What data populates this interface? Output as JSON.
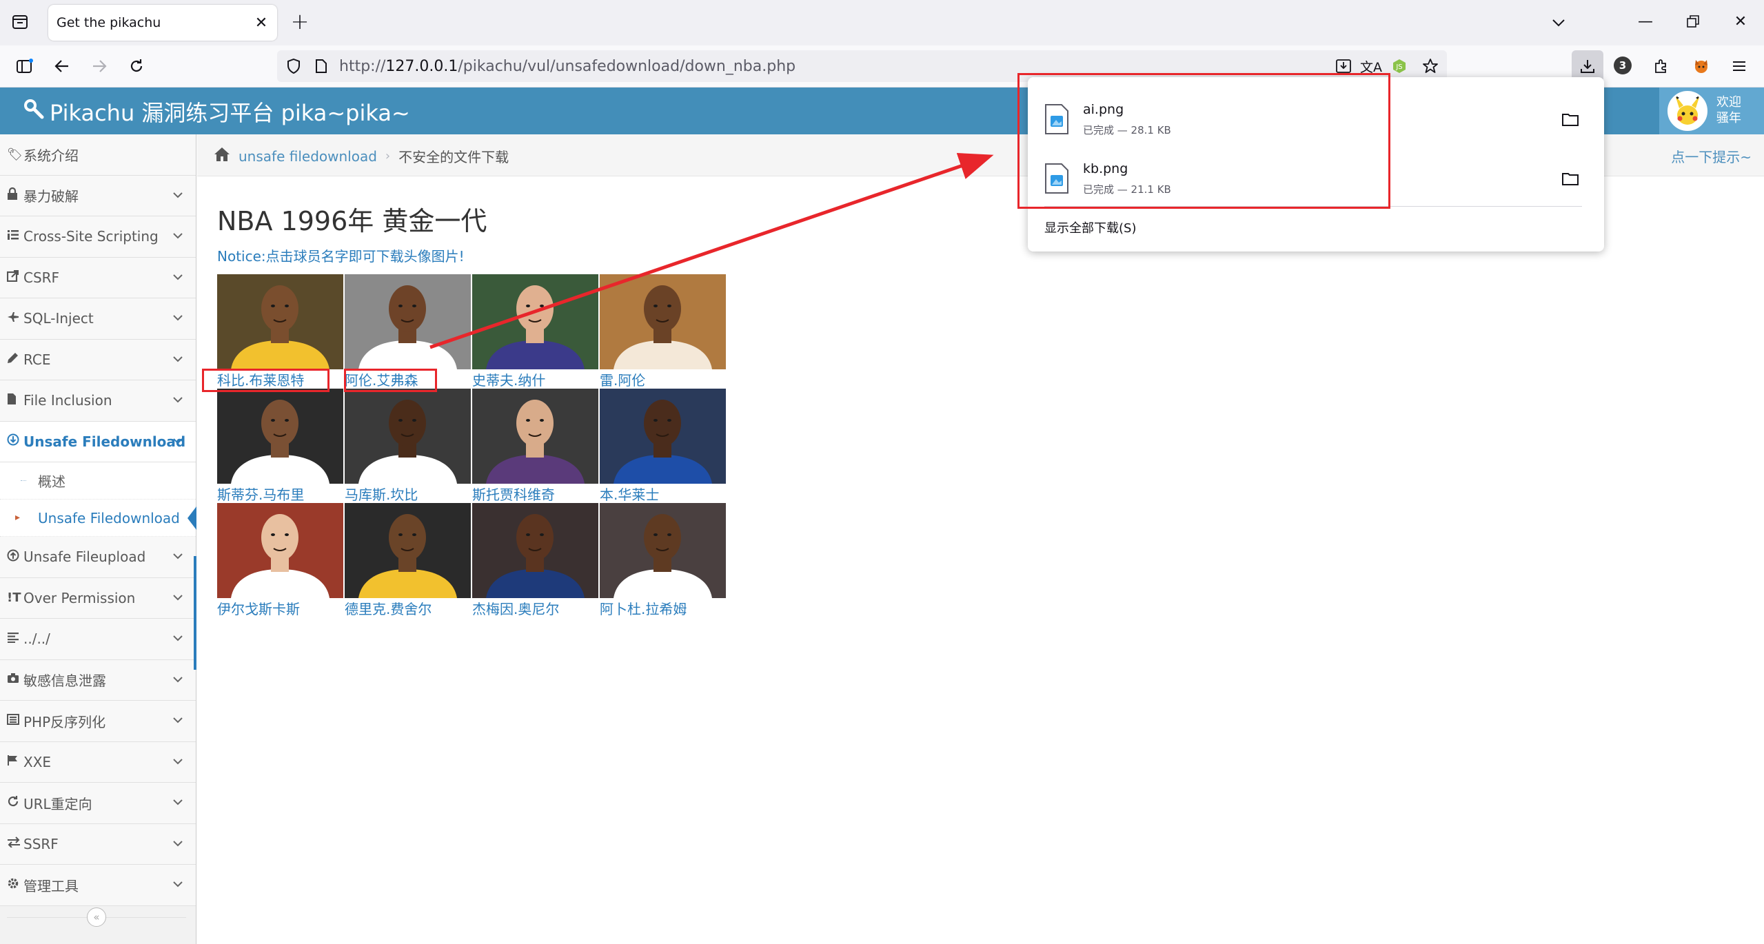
{
  "browser": {
    "tab_title": "Get the pikachu",
    "url_prefix": "http://",
    "url_host": "127.0.0.1",
    "url_path": "/pikachu/vul/unsafedownload/down_nba.php",
    "extensions_badge": "3"
  },
  "downloads_panel": {
    "items": [
      {
        "name": "ai.png",
        "status": "已完成 — 28.1 KB"
      },
      {
        "name": "kb.png",
        "status": "已完成 — 21.1 KB"
      }
    ],
    "show_all": "显示全部下载(S)"
  },
  "header": {
    "title": "Pikachu 漏洞练习平台 pika~pika~",
    "welcome_line1": "欢迎",
    "welcome_line2": "骚年"
  },
  "sidebar": {
    "items": [
      {
        "label": "系统介绍",
        "icon": "tags-icon"
      },
      {
        "label": "暴力破解",
        "icon": "lock-icon"
      },
      {
        "label": "Cross-Site Scripting",
        "icon": "list-icon"
      },
      {
        "label": "CSRF",
        "icon": "external-link-icon"
      },
      {
        "label": "SQL-Inject",
        "icon": "plane-icon"
      },
      {
        "label": "RCE",
        "icon": "pencil-icon"
      },
      {
        "label": "File Inclusion",
        "icon": "file-icon"
      },
      {
        "label": "Unsafe Filedownload",
        "icon": "download-circle-icon"
      },
      {
        "label": "Unsafe Fileupload",
        "icon": "upload-circle-icon"
      },
      {
        "label": "Over Permission",
        "icon": "text-cursor-icon"
      },
      {
        "label": "../../",
        "icon": "align-left-icon"
      },
      {
        "label": "敏感信息泄露",
        "icon": "camera-icon"
      },
      {
        "label": "PHP反序列化",
        "icon": "list-alt-icon"
      },
      {
        "label": "XXE",
        "icon": "flag-icon"
      },
      {
        "label": "URL重定向",
        "icon": "refresh-icon"
      },
      {
        "label": "SSRF",
        "icon": "exchange-icon"
      },
      {
        "label": "管理工具",
        "icon": "cog-icon"
      }
    ],
    "sub_items": [
      {
        "label": "概述"
      },
      {
        "label": "Unsafe Filedownload"
      }
    ]
  },
  "breadcrumb": {
    "link": "unsafe filedownload",
    "current": "不安全的文件下载",
    "hint": "点一下提示~"
  },
  "main": {
    "heading": "NBA 1996年 黄金一代",
    "notice": "Notice:点击球员名字即可下载头像图片!",
    "players": [
      {
        "name": "科比.布莱恩特",
        "bg": "#5a4a2a",
        "skin": "#7a4e2e",
        "jersey": "#f2c12e"
      },
      {
        "name": "阿伦.艾弗森",
        "bg": "#8a8a8a",
        "skin": "#6e4328",
        "jersey": "#ffffff"
      },
      {
        "name": "史蒂夫.纳什",
        "bg": "#3a5a3a",
        "skin": "#e0b090",
        "jersey": "#3b3a8a"
      },
      {
        "name": "雷.阿伦",
        "bg": "#b07a40",
        "skin": "#6a4226",
        "jersey": "#f4e8d8"
      },
      {
        "name": "斯蒂芬.马布里",
        "bg": "#2b2b2b",
        "skin": "#7a5034",
        "jersey": "#ffffff"
      },
      {
        "name": "马库斯.坎比",
        "bg": "#3a3a3a",
        "skin": "#4a2c1a",
        "jersey": "#ffffff"
      },
      {
        "name": "斯托贾科维奇",
        "bg": "#3a3a3a",
        "skin": "#d8ab8a",
        "jersey": "#5a3a7a"
      },
      {
        "name": "本.华莱士",
        "bg": "#2a3a5a",
        "skin": "#4a2c1c",
        "jersey": "#1e4ea8"
      },
      {
        "name": "伊尔戈斯卡斯",
        "bg": "#9a3a2a",
        "skin": "#e8c0a0",
        "jersey": "#ffffff"
      },
      {
        "name": "德里克.费舍尔",
        "bg": "#2a2a2a",
        "skin": "#6a4428",
        "jersey": "#f2c12e"
      },
      {
        "name": "杰梅因.奥尼尔",
        "bg": "#3a3030",
        "skin": "#5a3420",
        "jersey": "#1e3a7a"
      },
      {
        "name": "阿卜杜.拉希姆",
        "bg": "#4a4040",
        "skin": "#5e3a22",
        "jersey": "#ffffff"
      }
    ]
  },
  "colors": {
    "header_blue": "#438eb9",
    "link_blue": "#2b7dbc",
    "annotation_red": "#e8262b"
  }
}
